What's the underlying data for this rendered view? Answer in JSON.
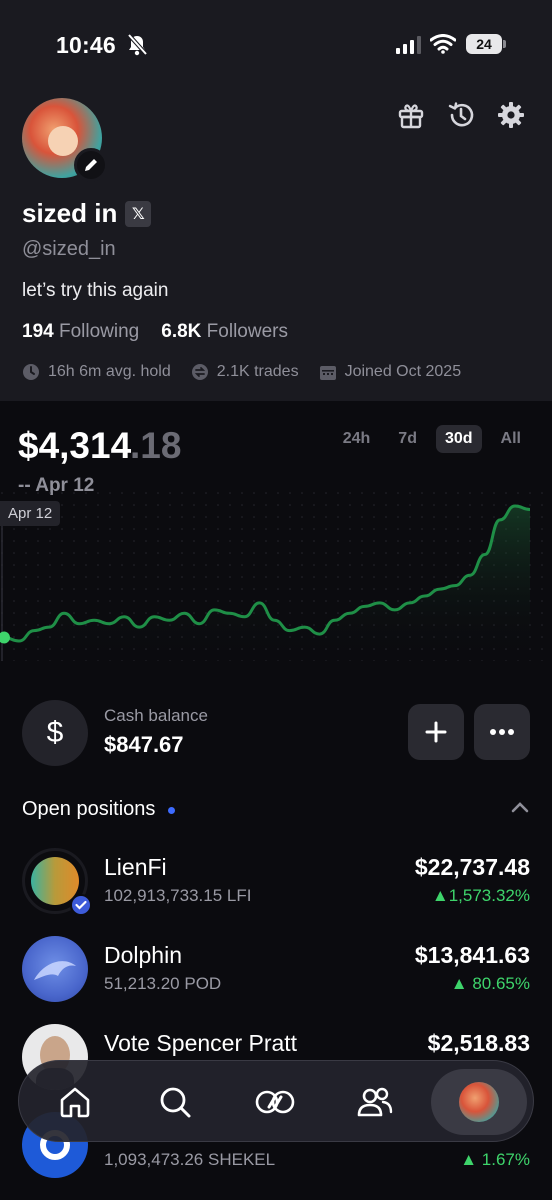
{
  "status_bar": {
    "time": "10:46",
    "battery": "24"
  },
  "profile": {
    "name": "sized in",
    "x_badge": "𝕏",
    "handle": "@sized_in",
    "bio": "let’s try this again",
    "following_count": "194",
    "following_label": "Following",
    "followers_count": "6.8K",
    "followers_label": "Followers",
    "avg_hold": "16h 6m avg. hold",
    "trades": "2.1K trades",
    "joined": "Joined Oct 2025"
  },
  "portfolio": {
    "value_main": "$4,314",
    "value_cents": ".18",
    "date_line": "-- Apr 12",
    "date_tag": "Apr 12",
    "ranges": [
      "24h",
      "7d",
      "30d",
      "All"
    ],
    "active_range": "30d"
  },
  "cash": {
    "label": "Cash balance",
    "value": "$847.67",
    "icon": "$"
  },
  "positions_header": {
    "title": "Open positions"
  },
  "positions": [
    {
      "name": "LienFi",
      "qty": "102,913,733.15 LFI",
      "value": "$22,737.48",
      "change": "▲1,573.32%"
    },
    {
      "name": "Dolphin",
      "qty": "51,213.20 POD",
      "value": "$13,841.63",
      "change": "▲ 80.65%"
    },
    {
      "name": "Vote Spencer Pratt",
      "qty": "",
      "value": "$2,518.83",
      "change": ""
    },
    {
      "name": "",
      "qty": "1,093,473.26 SHEKEL",
      "value": "",
      "change": "▲ 1.67%"
    }
  ],
  "colors": {
    "accent_green": "#3ed46b",
    "accent_blue": "#3d6bff",
    "background": "#0b0b0f"
  },
  "chart_data": {
    "type": "line",
    "series": [
      {
        "values": [
          48,
          47,
          50,
          51,
          55,
          52,
          53,
          52,
          54,
          51,
          54,
          53,
          55,
          52,
          56,
          55,
          54,
          58,
          53,
          50,
          51,
          49,
          53,
          55,
          57,
          58,
          56,
          58,
          60,
          62,
          63,
          66,
          72,
          82,
          86,
          85
        ]
      }
    ],
    "xlabel": "",
    "ylabel": "",
    "grid": false
  }
}
